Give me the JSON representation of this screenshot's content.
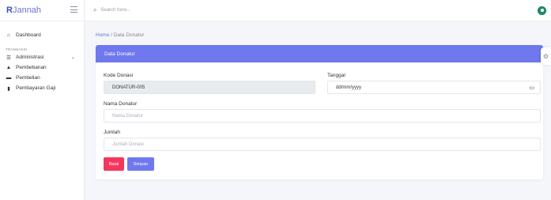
{
  "brand": {
    "prefix": "R",
    "rest": "Jannah"
  },
  "search": {
    "placeholder": "Search here..."
  },
  "sidebar": {
    "items": [
      {
        "label": "Dashboard",
        "icon": "home-icon"
      }
    ],
    "section_label": "TRANSAKSI",
    "group": {
      "label": "Administrasi",
      "icon": "list-icon"
    },
    "sub_items": [
      {
        "label": "Pembebanan",
        "icon": "bank-icon"
      },
      {
        "label": "Pembelian",
        "icon": "truck-icon"
      },
      {
        "label": "Pembayaran Gaji",
        "icon": "money-icon"
      }
    ]
  },
  "breadcrumb": {
    "home": "Home",
    "separator": "/",
    "current": "Data Donatur"
  },
  "card": {
    "title": "Data Donatur"
  },
  "form": {
    "kode_label": "Kode Donasi",
    "kode_value": "DONATUR-005",
    "tanggal_label": "Tanggal",
    "tanggal_value": "dd/mm/yyyy",
    "nama_label": "Nama Donatur",
    "nama_placeholder": "Nama Donatur",
    "jumlah_label": "Jumlah",
    "jumlah_placeholder": "Jumlah Donasi",
    "batal_label": "Batal",
    "simpan_label": "Simpan"
  },
  "colors": {
    "accent": "#6f78ed",
    "danger": "#f5365c",
    "brand": "#3d4bb5"
  }
}
